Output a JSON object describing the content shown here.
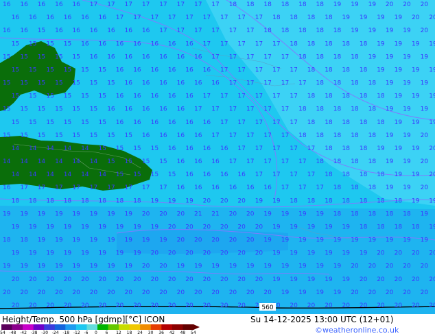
{
  "header": {
    "title": "Height/Temp. 500 hPa [gdmp][°C] ICON",
    "valid_time": "Su 14-12-2025 13:00 UTC (12+01)",
    "credit": "©weatheronline.co.uk"
  },
  "contour_label": "560",
  "colors": {
    "sea_cyan": "#1ec8f0",
    "sea_light": "#3cd2f5",
    "sea_blue": "#1e9cf0",
    "land_green": "#0a6e0a",
    "isotherm": "#7d7dff",
    "label_text": "#3a3aff"
  },
  "grid_rows": [
    {
      "v": [
        16,
        16,
        16,
        16,
        16,
        17,
        17,
        17,
        17,
        17,
        17,
        17,
        17,
        18,
        18,
        18,
        18,
        18,
        18,
        19,
        19,
        19,
        20,
        20,
        20
      ]
    },
    {
      "v": [
        16,
        16,
        16,
        16,
        16,
        16,
        17,
        17,
        17,
        17,
        17,
        17,
        17,
        17,
        17,
        18,
        18,
        18,
        18,
        19,
        19,
        19,
        19,
        20,
        20
      ]
    },
    {
      "v": [
        16,
        16,
        15,
        16,
        16,
        16,
        16,
        16,
        16,
        17,
        17,
        17,
        17,
        17,
        17,
        18,
        18,
        18,
        18,
        18,
        19,
        19,
        19,
        19,
        20
      ]
    },
    {
      "v": [
        15,
        15,
        15,
        15,
        16,
        16,
        16,
        16,
        16,
        16,
        16,
        17,
        17,
        17,
        17,
        17,
        18,
        18,
        18,
        18,
        18,
        19,
        19,
        19,
        19
      ]
    },
    {
      "v": [
        15,
        15,
        15,
        15,
        15,
        16,
        16,
        16,
        16,
        16,
        16,
        16,
        17,
        17,
        17,
        17,
        17,
        18,
        18,
        18,
        18,
        19,
        19,
        19,
        19
      ]
    },
    {
      "v": [
        15,
        15,
        15,
        15,
        15,
        15,
        16,
        16,
        16,
        16,
        16,
        16,
        17,
        17,
        17,
        17,
        17,
        18,
        18,
        18,
        18,
        19,
        19,
        19,
        19
      ]
    },
    {
      "v": [
        15,
        15,
        15,
        15,
        15,
        15,
        15,
        16,
        16,
        16,
        16,
        16,
        16,
        17,
        17,
        17,
        17,
        17,
        18,
        18,
        18,
        18,
        19,
        19,
        19
      ]
    },
    {
      "v": [
        15,
        15,
        15,
        15,
        15,
        15,
        16,
        16,
        16,
        16,
        16,
        17,
        17,
        17,
        17,
        17,
        17,
        18,
        18,
        18,
        18,
        18,
        19,
        19,
        19
      ]
    },
    {
      "v": [
        15,
        15,
        15,
        15,
        15,
        15,
        16,
        16,
        16,
        16,
        16,
        17,
        17,
        17,
        17,
        17,
        17,
        18,
        18,
        18,
        18,
        18,
        19,
        19,
        19
      ]
    },
    {
      "v": [
        15,
        15,
        15,
        15,
        15,
        15,
        16,
        16,
        16,
        16,
        16,
        16,
        17,
        17,
        17,
        17,
        17,
        18,
        18,
        18,
        18,
        18,
        19,
        19,
        19
      ]
    },
    {
      "v": [
        15,
        15,
        15,
        15,
        15,
        15,
        15,
        15,
        16,
        16,
        16,
        16,
        17,
        17,
        17,
        17,
        17,
        18,
        18,
        18,
        18,
        18,
        19,
        19,
        20
      ]
    },
    {
      "v": [
        14,
        14,
        14,
        14,
        14,
        15,
        15,
        15,
        15,
        16,
        16,
        16,
        16,
        17,
        17,
        17,
        17,
        17,
        18,
        18,
        18,
        19,
        19,
        19,
        20
      ]
    },
    {
      "v": [
        14,
        14,
        14,
        14,
        14,
        14,
        15,
        15,
        15,
        15,
        16,
        16,
        16,
        17,
        17,
        17,
        17,
        17,
        18,
        18,
        18,
        18,
        19,
        19,
        20
      ]
    },
    {
      "v": [
        14,
        14,
        14,
        14,
        14,
        14,
        15,
        15,
        15,
        15,
        16,
        16,
        16,
        16,
        17,
        17,
        17,
        17,
        18,
        18,
        18,
        18,
        19,
        19,
        20
      ]
    },
    {
      "v": [
        16,
        17,
        17,
        17,
        17,
        17,
        17,
        17,
        17,
        17,
        16,
        16,
        16,
        16,
        16,
        16,
        17,
        17,
        17,
        18,
        18,
        18,
        19,
        19,
        20
      ]
    },
    {
      "v": [
        18,
        18,
        18,
        18,
        18,
        18,
        18,
        18,
        19,
        19,
        19,
        20,
        20,
        20,
        19,
        19,
        18,
        18,
        18,
        18,
        18,
        18,
        18,
        19,
        19
      ]
    },
    {
      "v": [
        19,
        19,
        19,
        19,
        19,
        19,
        19,
        19,
        20,
        20,
        20,
        21,
        21,
        20,
        20,
        19,
        19,
        19,
        19,
        18,
        18,
        18,
        18,
        18,
        19
      ]
    },
    {
      "v": [
        19,
        19,
        19,
        19,
        19,
        19,
        19,
        19,
        19,
        20,
        20,
        20,
        20,
        20,
        20,
        19,
        19,
        19,
        19,
        19,
        18,
        18,
        18,
        18,
        19
      ]
    },
    {
      "v": [
        18,
        18,
        19,
        19,
        19,
        19,
        19,
        19,
        19,
        19,
        20,
        20,
        20,
        20,
        20,
        19,
        19,
        19,
        19,
        19,
        19,
        19,
        19,
        19,
        19
      ]
    },
    {
      "v": [
        19,
        19,
        19,
        19,
        19,
        19,
        19,
        19,
        20,
        20,
        20,
        20,
        20,
        20,
        20,
        19,
        19,
        19,
        19,
        19,
        19,
        20,
        20,
        20,
        20
      ]
    },
    {
      "v": [
        19,
        19,
        19,
        19,
        19,
        19,
        19,
        19,
        20,
        20,
        19,
        19,
        19,
        19,
        19,
        19,
        19,
        19,
        19,
        19,
        20,
        20,
        20,
        20,
        20
      ]
    },
    {
      "v": [
        20,
        20,
        20,
        20,
        20,
        20,
        20,
        20,
        20,
        20,
        20,
        20,
        20,
        20,
        20,
        19,
        19,
        19,
        19,
        19,
        20,
        20,
        20,
        20,
        20
      ]
    },
    {
      "v": [
        20,
        20,
        20,
        20,
        20,
        20,
        20,
        20,
        20,
        20,
        20,
        20,
        20,
        20,
        20,
        20,
        19,
        19,
        19,
        19,
        20,
        20,
        20,
        20,
        20
      ]
    },
    {
      "v": [
        20,
        20,
        20,
        20,
        20,
        20,
        20,
        20,
        20,
        20,
        20,
        20,
        20,
        20,
        20,
        20,
        20,
        20,
        20,
        20,
        20,
        20,
        20,
        20,
        20
      ]
    }
  ],
  "legend": {
    "ticks": [
      "-54",
      "-48",
      "-42",
      "-38",
      "-30",
      "-24",
      "-18",
      "-12",
      "-6",
      "0",
      "6",
      "12",
      "18",
      "24",
      "30",
      "36",
      "42",
      "48",
      "54"
    ],
    "colors": [
      "#5a005a",
      "#8c008c",
      "#c800c8",
      "#6e00c8",
      "#3c3cdc",
      "#1464dc",
      "#1e9cf0",
      "#1ec8f0",
      "#64dcdc",
      "#00b400",
      "#64c800",
      "#c8dc00",
      "#f0c800",
      "#f08c00",
      "#e63c00",
      "#b40000",
      "#8c0000",
      "#640000"
    ]
  }
}
